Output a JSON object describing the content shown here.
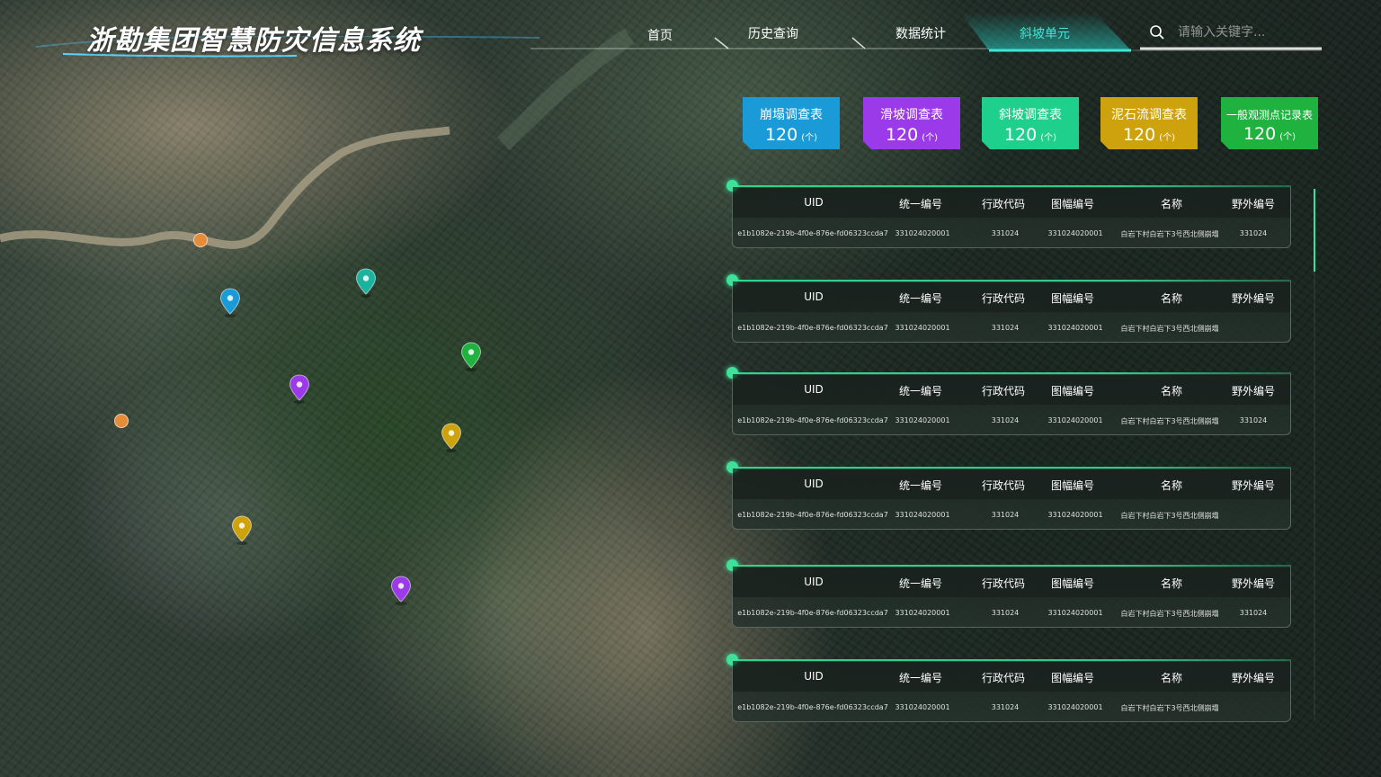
{
  "header": {
    "title": "浙勘集团智慧防灾信息系统",
    "nav": [
      {
        "label": "首页",
        "active": false
      },
      {
        "label": "历史查询",
        "active": false
      },
      {
        "label": "数据统计",
        "active": false
      },
      {
        "label": "斜坡单元",
        "active": true
      }
    ],
    "search": {
      "placeholder": "请输入关键字..."
    }
  },
  "cards": [
    {
      "title": "崩塌调查表",
      "count": "120",
      "unit": "(个)",
      "color": "#1a9ad6"
    },
    {
      "title": "滑坡调查表",
      "count": "120",
      "unit": "(个)",
      "color": "#9b3ae8"
    },
    {
      "title": "斜坡调查表",
      "count": "120",
      "unit": "(个)",
      "color": "#1fcf8c"
    },
    {
      "title": "泥石流调查表",
      "count": "120",
      "unit": "(个)",
      "color": "#cda20d"
    },
    {
      "title": "一般观测点记录表",
      "count": "120",
      "unit": "(个)",
      "color": "#1fb23f"
    }
  ],
  "table_headers": [
    "UID",
    "统一编号",
    "行政代码",
    "图幅编号",
    "名称",
    "野外编号"
  ],
  "records": [
    {
      "uid": "e1b1082e-219b-4f0e-876e-fd06323ccda7",
      "unified_no": "331024020001",
      "admin_code": "331024",
      "map_no": "331024020001",
      "name": "白岩下村白岩下3号西北侧崩塌",
      "field_no": "331024"
    },
    {
      "uid": "e1b1082e-219b-4f0e-876e-fd06323ccda7",
      "unified_no": "331024020001",
      "admin_code": "331024",
      "map_no": "331024020001",
      "name": "白岩下村白岩下3号西北侧崩塌",
      "field_no": ""
    },
    {
      "uid": "e1b1082e-219b-4f0e-876e-fd06323ccda7",
      "unified_no": "331024020001",
      "admin_code": "331024",
      "map_no": "331024020001",
      "name": "白岩下村白岩下3号西北侧崩塌",
      "field_no": "331024"
    },
    {
      "uid": "e1b1082e-219b-4f0e-876e-fd06323ccda7",
      "unified_no": "331024020001",
      "admin_code": "331024",
      "map_no": "331024020001",
      "name": "白岩下村白岩下3号西北侧崩塌",
      "field_no": ""
    },
    {
      "uid": "e1b1082e-219b-4f0e-876e-fd06323ccda7",
      "unified_no": "331024020001",
      "admin_code": "331024",
      "map_no": "331024020001",
      "name": "白岩下村白岩下3号西北侧崩塌",
      "field_no": "331024"
    },
    {
      "uid": "e1b1082e-219b-4f0e-876e-fd06323ccda7",
      "unified_no": "331024020001",
      "admin_code": "331024",
      "map_no": "331024020001",
      "name": "白岩下村白岩下3号西北侧崩塌",
      "field_no": ""
    }
  ],
  "map_markers": [
    {
      "type": "collapse",
      "color": "#1a9ad6"
    },
    {
      "type": "slope",
      "color": "#19b3a0"
    },
    {
      "type": "observation",
      "color": "#1fb23f"
    },
    {
      "type": "landslide",
      "color": "#9b3ae8"
    },
    {
      "type": "debris-flow",
      "color": "#cda20d"
    },
    {
      "type": "debris-flow",
      "color": "#cda20d"
    },
    {
      "type": "landslide",
      "color": "#9b3ae8"
    }
  ],
  "map_pois": [
    {
      "icon": "building-icon",
      "color": "#e58c3b"
    },
    {
      "icon": "home-icon",
      "color": "#e58c3b"
    }
  ]
}
